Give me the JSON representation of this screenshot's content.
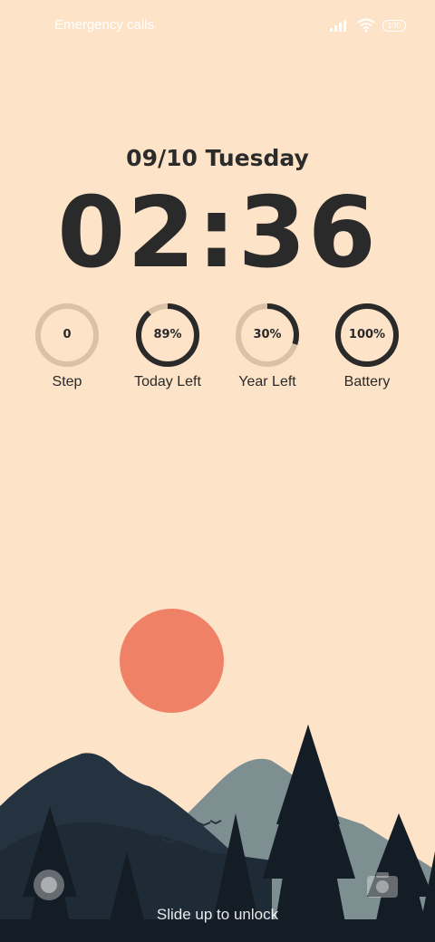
{
  "status_bar": {
    "left_text": "Emergency calls",
    "battery_level": "100",
    "icons": [
      "signal-icon",
      "wifi-icon",
      "battery-icon"
    ]
  },
  "lockscreen": {
    "date": "09/10 Tuesday",
    "time": "02:36"
  },
  "widgets": [
    {
      "label": "Step",
      "value": "0",
      "progress": 0
    },
    {
      "label": "Today Left",
      "value": "89%",
      "progress": 0.89
    },
    {
      "label": "Year Left",
      "value": "30%",
      "progress": 0.3
    },
    {
      "label": "Battery",
      "value": "100%",
      "progress": 1.0
    }
  ],
  "bottom": {
    "unlock_hint": "Slide up to unlock",
    "left_shortcut": "lock-shortcut-icon",
    "right_shortcut": "camera-icon"
  },
  "colors": {
    "background": "#fde3c8",
    "ring_track": "#d9c2a8",
    "ring_fill": "#2a2a2a",
    "sun": "#ef8166",
    "mountain_dark": "#253341",
    "mountain_light": "#7e8f92"
  }
}
